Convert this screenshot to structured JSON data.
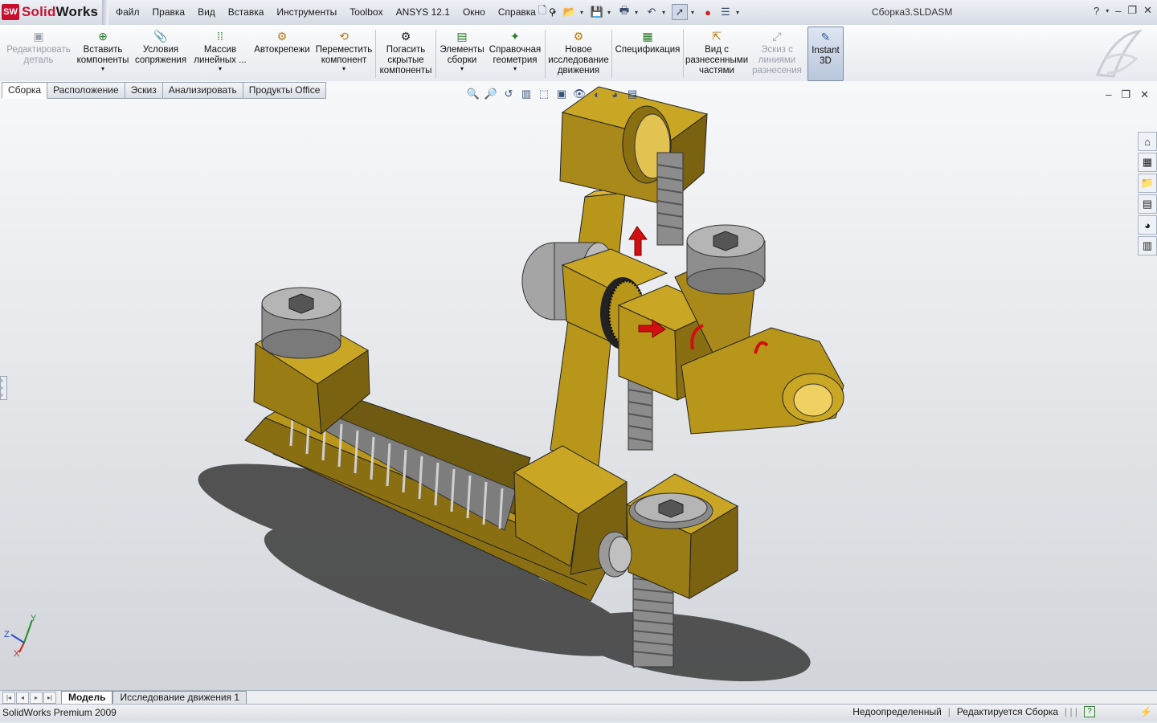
{
  "app": {
    "brand_prefix": "SW",
    "brand_a": "Solid",
    "brand_b": "Works",
    "document_title": "Сборка3.SLDASM"
  },
  "menu": [
    "Файл",
    "Правка",
    "Вид",
    "Вставка",
    "Инструменты",
    "Toolbox",
    "ANSYS 12.1",
    "Окно",
    "Справка"
  ],
  "command_manager": {
    "buttons": [
      {
        "label_1": "Редактировать",
        "label_2": "деталь",
        "label_3": "",
        "icon": "edit-part-icon",
        "enabled": false
      },
      {
        "label_1": "Вставить",
        "label_2": "компоненты",
        "label_3": "",
        "icon": "insert-components-icon",
        "enabled": true
      },
      {
        "label_1": "Условия",
        "label_2": "сопряжения",
        "label_3": "",
        "icon": "mate-icon",
        "enabled": true
      },
      {
        "label_1": "Массив",
        "label_2": "линейных ...",
        "label_3": "",
        "icon": "linear-pattern-icon",
        "enabled": true
      },
      {
        "label_1": "Автокрепежи",
        "label_2": "",
        "label_3": "",
        "icon": "smart-fasteners-icon",
        "enabled": true
      },
      {
        "label_1": "Переместить",
        "label_2": "компонент",
        "label_3": "",
        "icon": "move-component-icon",
        "enabled": true
      },
      {
        "label_1": "Погасить",
        "label_2": "скрытые",
        "label_3": "компоненты",
        "icon": "hide-components-icon",
        "enabled": true
      },
      {
        "label_1": "Элементы",
        "label_2": "сборки",
        "label_3": "",
        "icon": "assembly-features-icon",
        "enabled": true
      },
      {
        "label_1": "Справочная",
        "label_2": "геометрия",
        "label_3": "",
        "icon": "reference-geometry-icon",
        "enabled": true
      },
      {
        "label_1": "Новое",
        "label_2": "исследование",
        "label_3": "движения",
        "icon": "motion-study-icon",
        "enabled": true
      },
      {
        "label_1": "Спецификация",
        "label_2": "",
        "label_3": "",
        "icon": "bom-icon",
        "enabled": true
      },
      {
        "label_1": "Вид с",
        "label_2": "разнесенными",
        "label_3": "частями",
        "icon": "exploded-view-icon",
        "enabled": true
      },
      {
        "label_1": "Эскиз с",
        "label_2": "линиями",
        "label_3": "разнесения",
        "icon": "explode-line-sketch-icon",
        "enabled": false
      },
      {
        "label_1": "Instant",
        "label_2": "3D",
        "label_3": "",
        "icon": "instant3d-icon",
        "enabled": true,
        "active": true
      }
    ]
  },
  "tabs": [
    "Сборка",
    "Расположение",
    "Эскиз",
    "Анализировать",
    "Продукты Office"
  ],
  "bottom_tabs": [
    "Модель",
    "Исследование движения 1"
  ],
  "status": {
    "product": "SolidWorks Premium 2009",
    "state": "Недоопределенный",
    "editing": "Редактируется Сборка"
  },
  "triad": {
    "x": "X",
    "y": "Y",
    "z": "Z"
  },
  "colors": {
    "part": "#b8961a",
    "part_dark": "#8a6f12",
    "screw": "#9c9c9c",
    "arrow": "#d01010",
    "brand": "#c8102e"
  }
}
